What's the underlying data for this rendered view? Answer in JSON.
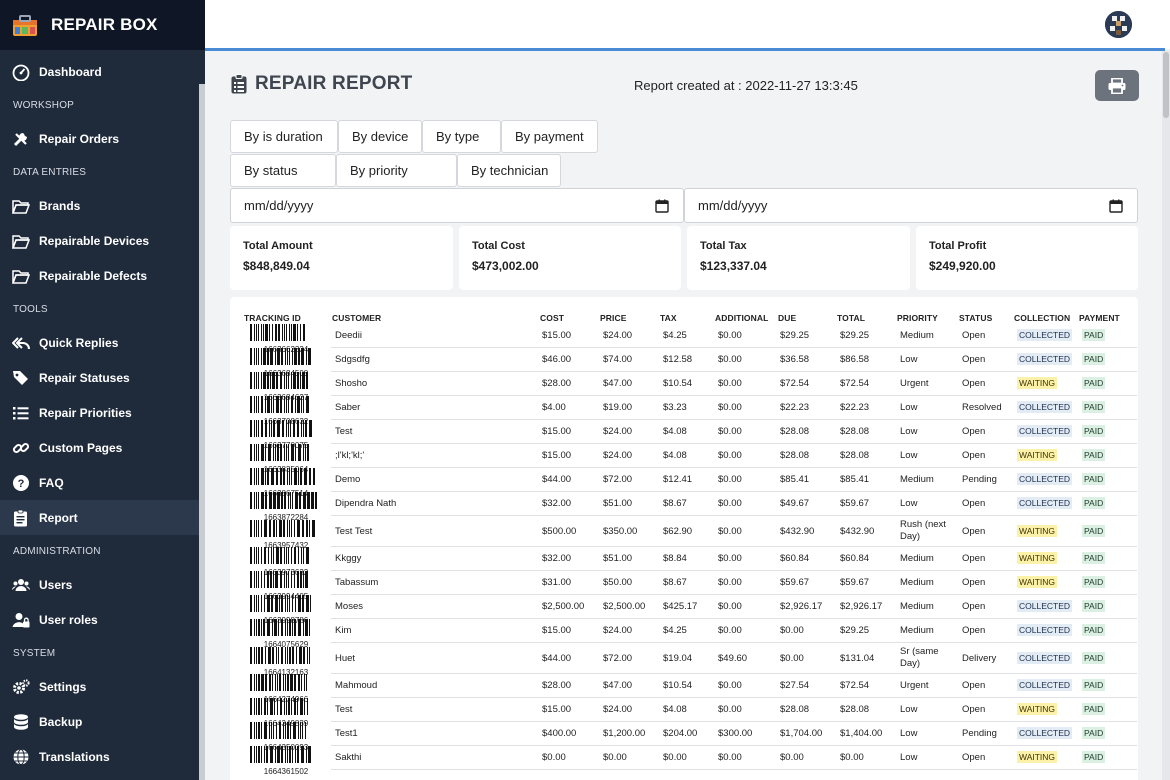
{
  "app": {
    "name": "REPAIR BOX"
  },
  "sidebar": {
    "items": [
      {
        "type": "item",
        "label": "Dashboard",
        "icon": "dashboard-icon"
      },
      {
        "type": "section",
        "label": "WORKSHOP"
      },
      {
        "type": "item",
        "label": "Repair Orders",
        "icon": "tools-icon"
      },
      {
        "type": "section",
        "label": "DATA ENTRIES"
      },
      {
        "type": "item",
        "label": "Brands",
        "icon": "folder-open-icon"
      },
      {
        "type": "item",
        "label": "Repairable Devices",
        "icon": "folder-open-icon"
      },
      {
        "type": "item",
        "label": "Repairable Defects",
        "icon": "folder-open-icon"
      },
      {
        "type": "section",
        "label": "TOOLS"
      },
      {
        "type": "item",
        "label": "Quick Replies",
        "icon": "reply-all-icon"
      },
      {
        "type": "item",
        "label": "Repair Statuses",
        "icon": "tags-icon"
      },
      {
        "type": "item",
        "label": "Repair Priorities",
        "icon": "list-icon"
      },
      {
        "type": "item",
        "label": "Custom Pages",
        "icon": "link-icon"
      },
      {
        "type": "item",
        "label": "FAQ",
        "icon": "question-circle-icon"
      },
      {
        "type": "item",
        "label": "Report",
        "icon": "clipboard-icon",
        "active": true
      },
      {
        "type": "section",
        "label": "ADMINISTRATION"
      },
      {
        "type": "item",
        "label": "Users",
        "icon": "users-icon"
      },
      {
        "type": "item",
        "label": "User roles",
        "icon": "user-lock-icon"
      },
      {
        "type": "section",
        "label": "SYSTEM"
      },
      {
        "type": "item",
        "label": "Settings",
        "icon": "cogs-icon"
      },
      {
        "type": "item",
        "label": "Backup",
        "icon": "database-icon"
      },
      {
        "type": "item",
        "label": "Translations",
        "icon": "globe-icon"
      }
    ]
  },
  "report": {
    "title": "REPAIR REPORT",
    "created": "Report created at : 2022-11-27 13:3:45",
    "filters": [
      "By is duration",
      "By device",
      "By type",
      "By payment",
      "By status",
      "By priority",
      "By technician"
    ],
    "date_from": "mm/dd/yyyy",
    "date_to": "mm/dd/yyyy"
  },
  "stats": [
    {
      "label": "Total Amount",
      "value": "$848,849.04"
    },
    {
      "label": "Total Cost",
      "value": "$473,002.00"
    },
    {
      "label": "Total Tax",
      "value": "$123,337.04"
    },
    {
      "label": "Total Profit",
      "value": "$249,920.00"
    }
  ],
  "table": {
    "headers": [
      "TRACKING ID",
      "CUSTOMER",
      "COST",
      "PRICE",
      "TAX",
      "ADDITIONAL",
      "DUE",
      "TOTAL",
      "PRIORITY",
      "STATUS",
      "COLLECTION",
      "PAYMENT"
    ],
    "rows": [
      {
        "id": "1663662334",
        "customer": "Deedii",
        "cost": "$15.00",
        "price": "$24.00",
        "tax": "$4.25",
        "additional": "$0.00",
        "due": "$29.25",
        "total": "$29.25",
        "priority": "Medium",
        "status": "Open",
        "collection": "COLLECTED",
        "payment": "PAID"
      },
      {
        "id": "1663684508",
        "customer": "Sdgsdfg",
        "cost": "$46.00",
        "price": "$74.00",
        "tax": "$12.58",
        "additional": "$0.00",
        "due": "$36.58",
        "total": "$86.58",
        "priority": "Low",
        "status": "Open",
        "collection": "COLLECTED",
        "payment": "PAID"
      },
      {
        "id": "1663684627",
        "customer": "Shosho",
        "cost": "$28.00",
        "price": "$47.00",
        "tax": "$10.54",
        "additional": "$0.00",
        "due": "$72.54",
        "total": "$72.54",
        "priority": "Urgent",
        "status": "Open",
        "collection": "WAITING",
        "payment": "PAID"
      },
      {
        "id": "1663708632",
        "customer": "Saber",
        "cost": "$4.00",
        "price": "$19.00",
        "tax": "$3.23",
        "additional": "$0.00",
        "due": "$22.23",
        "total": "$22.23",
        "priority": "Low",
        "status": "Resolved",
        "collection": "COLLECTED",
        "payment": "PAID"
      },
      {
        "id": "1663770075",
        "customer": "Test",
        "cost": "$15.00",
        "price": "$24.00",
        "tax": "$4.08",
        "additional": "$0.00",
        "due": "$28.08",
        "total": "$28.08",
        "priority": "Low",
        "status": "Open",
        "collection": "COLLECTED",
        "payment": "PAID"
      },
      {
        "id": "1663835064",
        "customer": ";l'kl;'kl;'",
        "cost": "$15.00",
        "price": "$24.00",
        "tax": "$4.08",
        "additional": "$0.00",
        "due": "$28.08",
        "total": "$28.08",
        "priority": "Low",
        "status": "Open",
        "collection": "WAITING",
        "payment": "PAID"
      },
      {
        "id": "1663867514",
        "customer": "Demo",
        "cost": "$44.00",
        "price": "$72.00",
        "tax": "$12.41",
        "additional": "$0.00",
        "due": "$85.41",
        "total": "$85.41",
        "priority": "Medium",
        "status": "Pending",
        "collection": "COLLECTED",
        "payment": "PAID"
      },
      {
        "id": "1663872284",
        "customer": "Dipendra Nath",
        "cost": "$32.00",
        "price": "$51.00",
        "tax": "$8.67",
        "additional": "$0.00",
        "due": "$49.67",
        "total": "$59.67",
        "priority": "Low",
        "status": "Open",
        "collection": "COLLECTED",
        "payment": "PAID"
      },
      {
        "id": "1663957432",
        "customer": "Test Test",
        "cost": "$500.00",
        "price": "$350.00",
        "tax": "$62.90",
        "additional": "$0.00",
        "due": "$432.90",
        "total": "$432.90",
        "priority": "Rush (next Day)",
        "status": "Open",
        "collection": "WAITING",
        "payment": "PAID"
      },
      {
        "id": "1663973632",
        "customer": "Kkggy",
        "cost": "$32.00",
        "price": "$51.00",
        "tax": "$8.84",
        "additional": "$0.00",
        "due": "$60.84",
        "total": "$60.84",
        "priority": "Medium",
        "status": "Open",
        "collection": "WAITING",
        "payment": "PAID"
      },
      {
        "id": "1663994405",
        "customer": "Tabassum",
        "cost": "$31.00",
        "price": "$50.00",
        "tax": "$8.67",
        "additional": "$0.00",
        "due": "$59.67",
        "total": "$59.67",
        "priority": "Medium",
        "status": "Open",
        "collection": "WAITING",
        "payment": "PAID"
      },
      {
        "id": "1663998786",
        "customer": "Moses",
        "cost": "$2,500.00",
        "price": "$2,500.00",
        "tax": "$425.17",
        "additional": "$0.00",
        "due": "$2,926.17",
        "total": "$2,926.17",
        "priority": "Medium",
        "status": "Open",
        "collection": "COLLECTED",
        "payment": "PAID"
      },
      {
        "id": "1664075629",
        "customer": "Kim",
        "cost": "$15.00",
        "price": "$24.00",
        "tax": "$4.25",
        "additional": "$0.00",
        "due": "$0.00",
        "total": "$29.25",
        "priority": "Medium",
        "status": "Open",
        "collection": "COLLECTED",
        "payment": "PAID"
      },
      {
        "id": "1664132163",
        "customer": "Huet",
        "cost": "$44.00",
        "price": "$72.00",
        "tax": "$19.04",
        "additional": "$49.60",
        "due": "$0.00",
        "total": "$131.04",
        "priority": "Sr (same Day)",
        "status": "Delivery",
        "collection": "COLLECTED",
        "payment": "PAID"
      },
      {
        "id": "1664274966",
        "customer": "Mahmoud",
        "cost": "$28.00",
        "price": "$47.00",
        "tax": "$10.54",
        "additional": "$0.00",
        "due": "$27.54",
        "total": "$72.54",
        "priority": "Urgent",
        "status": "Open",
        "collection": "COLLECTED",
        "payment": "PAID"
      },
      {
        "id": "1664349839",
        "customer": "Test",
        "cost": "$15.00",
        "price": "$24.00",
        "tax": "$4.08",
        "additional": "$0.00",
        "due": "$28.08",
        "total": "$28.08",
        "priority": "Low",
        "status": "Open",
        "collection": "WAITING",
        "payment": "PAID"
      },
      {
        "id": "1664350093",
        "customer": "Test1",
        "cost": "$400.00",
        "price": "$1,200.00",
        "tax": "$204.00",
        "additional": "$300.00",
        "due": "$1,704.00",
        "total": "$1,404.00",
        "priority": "Low",
        "status": "Pending",
        "collection": "COLLECTED",
        "payment": "PAID"
      },
      {
        "id": "1664361502",
        "customer": "Sakthi",
        "cost": "$0.00",
        "price": "$0.00",
        "tax": "$0.00",
        "additional": "$0.00",
        "due": "$0.00",
        "total": "$0.00",
        "priority": "Low",
        "status": "Open",
        "collection": "WAITING",
        "payment": "PAID"
      }
    ]
  }
}
